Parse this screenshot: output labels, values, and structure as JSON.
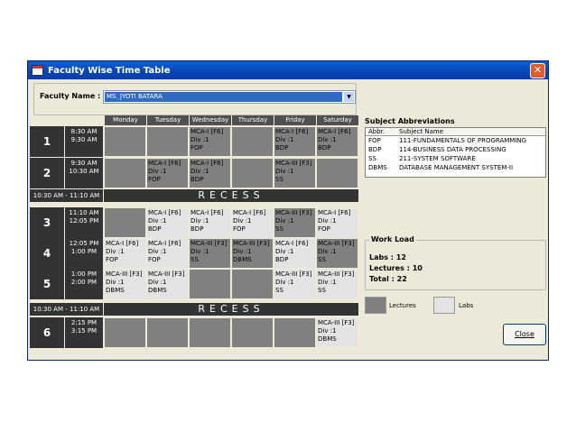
{
  "window": {
    "title": "Faculty Wise Time Table",
    "close_glyph": "✕"
  },
  "faculty": {
    "label": "Faculty Name :",
    "value": "MS. JYOTI BATARA",
    "dropdown_glyph": "▼"
  },
  "days": [
    "Monday",
    "Tuesday",
    "Wednesday",
    "Thursday",
    "Friday",
    "Saturday"
  ],
  "periods": [
    {
      "num": "1",
      "start": "8:30 AM",
      "end": "9:30 AM",
      "cells": [
        {
          "shade": "dark",
          "lines": []
        },
        {
          "shade": "dark",
          "lines": []
        },
        {
          "shade": "dark",
          "lines": [
            "MCA-I [F6]",
            "Div :1",
            "FOP"
          ]
        },
        {
          "shade": "dark",
          "lines": []
        },
        {
          "shade": "dark",
          "lines": [
            "MCA-I [F6]",
            "Div :1",
            "BDP"
          ]
        },
        {
          "shade": "dark",
          "lines": [
            "MCA-I [F6]",
            "Div :1",
            "BDP"
          ]
        }
      ]
    },
    {
      "num": "2",
      "start": "9:30 AM",
      "end": "10:30 AM",
      "cells": [
        {
          "shade": "dark",
          "lines": []
        },
        {
          "shade": "dark",
          "lines": [
            "MCA-I [F6]",
            "Div :1",
            "FOP"
          ]
        },
        {
          "shade": "dark",
          "lines": [
            "MCA-I [F6]",
            "Div :1",
            "BDP"
          ]
        },
        {
          "shade": "dark",
          "lines": []
        },
        {
          "shade": "dark",
          "lines": [
            "MCA-III [F3]",
            "Div :1",
            "SS"
          ]
        },
        {
          "shade": "dark",
          "lines": []
        }
      ]
    },
    {
      "num": "3",
      "start": "11:10 AM",
      "end": "12:05 PM",
      "cells": [
        {
          "shade": "dark",
          "lines": []
        },
        {
          "shade": "light",
          "lines": [
            "MCA-I [F6]",
            "Div :1",
            "BDP"
          ]
        },
        {
          "shade": "light",
          "lines": [
            "MCA-I [F6]",
            "Div :1",
            "BDP"
          ]
        },
        {
          "shade": "light",
          "lines": [
            "MCA-I [F6]",
            "Div :1",
            "FOP"
          ]
        },
        {
          "shade": "dark",
          "lines": [
            "MCA-III [F3]",
            "Div :1",
            "SS"
          ]
        },
        {
          "shade": "light",
          "lines": [
            "MCA-I [F6]",
            "Div :1",
            "FOP"
          ]
        }
      ]
    },
    {
      "num": "4",
      "start": "12:05 PM",
      "end": "1:00 PM",
      "cells": [
        {
          "shade": "light",
          "lines": [
            "MCA-I [F6]",
            "Div :1",
            "FOP"
          ]
        },
        {
          "shade": "light",
          "lines": [
            "MCA-I [F6]",
            "Div :1",
            "FOP"
          ]
        },
        {
          "shade": "dark",
          "lines": [
            "MCA-III [F3]",
            "Div :1",
            "SS"
          ]
        },
        {
          "shade": "dark",
          "lines": [
            "MCA-III [F3]",
            "Div :1",
            "DBMS"
          ]
        },
        {
          "shade": "light",
          "lines": [
            "MCA-I [F6]",
            "Div :1",
            "BDP"
          ]
        },
        {
          "shade": "dark",
          "lines": [
            "MCA-III [F3]",
            "Div :1",
            "SS"
          ]
        }
      ]
    },
    {
      "num": "5",
      "start": "1:00 PM",
      "end": "2:00 PM",
      "cells": [
        {
          "shade": "light",
          "lines": [
            "MCA-III [F3]",
            "Div :1",
            "DBMS"
          ]
        },
        {
          "shade": "light",
          "lines": [
            "MCA-III [F3]",
            "Div :1",
            "DBMS"
          ]
        },
        {
          "shade": "dark",
          "lines": []
        },
        {
          "shade": "dark",
          "lines": []
        },
        {
          "shade": "light",
          "lines": [
            "MCA-III [F3]",
            "Div :1",
            "SS"
          ]
        },
        {
          "shade": "light",
          "lines": [
            "MCA-III [F3]",
            "Div :1",
            "SS"
          ]
        }
      ]
    },
    {
      "num": "6",
      "start": "2:15 PM",
      "end": "3:15 PM",
      "cells": [
        {
          "shade": "dark",
          "lines": []
        },
        {
          "shade": "dark",
          "lines": []
        },
        {
          "shade": "dark",
          "lines": []
        },
        {
          "shade": "dark",
          "lines": []
        },
        {
          "shade": "dark",
          "lines": []
        },
        {
          "shade": "light",
          "lines": [
            "MCA-III [F3]",
            "Div :1",
            "DBMS"
          ]
        }
      ]
    }
  ],
  "recess": {
    "time": "10:30 AM - 11:10 AM",
    "label": "RECESS"
  },
  "abbreviations": {
    "title": "Subject Abbreviations",
    "headers": [
      "Abbr.",
      "Subject Name"
    ],
    "rows": [
      {
        "abbr": "FOP",
        "name": "111-FUNDAMENTALS OF PROGRAMMING"
      },
      {
        "abbr": "BDP",
        "name": "114-BUSINESS DATA PROCESSING"
      },
      {
        "abbr": "SS",
        "name": "211-SYSTEM SOFTWARE"
      },
      {
        "abbr": "DBMS",
        "name": "DATABASE MANAGEMENT SYSTEM-II"
      }
    ]
  },
  "workload": {
    "title": "Work Load",
    "labs": "Labs : 12",
    "lectures": "Lectures : 10",
    "total": "Total : 22"
  },
  "legend": {
    "lectures": "Lectures",
    "labs": "Labs",
    "lectures_color": "#808080",
    "labs_color": "#e3e3e3"
  },
  "close_button": "Close"
}
